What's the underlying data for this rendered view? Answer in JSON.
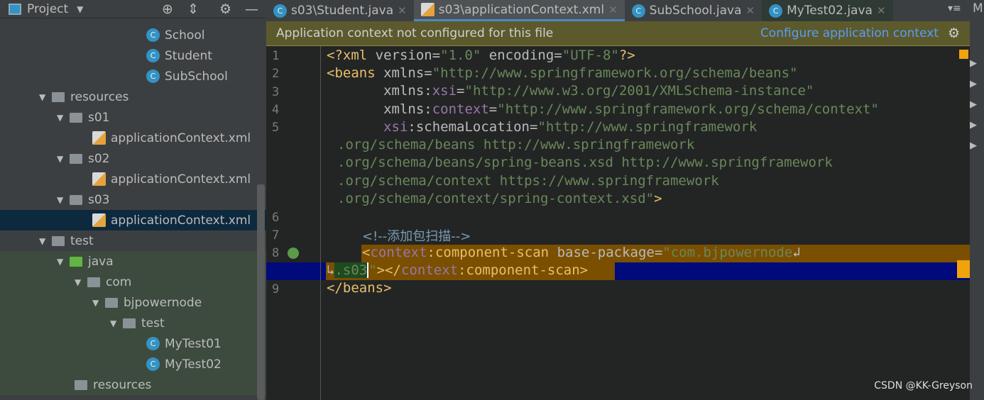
{
  "project_panel": {
    "title": "Project",
    "tree": [
      {
        "label": "School",
        "type": "class",
        "indent": 206
      },
      {
        "label": "Student",
        "type": "class",
        "indent": 206
      },
      {
        "label": "SubSchool",
        "type": "class",
        "indent": 206
      },
      {
        "label": "resources",
        "type": "resfolder",
        "indent": 55,
        "open": true
      },
      {
        "label": "s01",
        "type": "folder",
        "indent": 80,
        "open": true
      },
      {
        "label": "applicationContext.xml",
        "type": "xml",
        "indent": 130
      },
      {
        "label": "s02",
        "type": "folder",
        "indent": 80,
        "open": true
      },
      {
        "label": "applicationContext.xml",
        "type": "xml",
        "indent": 130
      },
      {
        "label": "s03",
        "type": "folder",
        "indent": 80,
        "open": true
      },
      {
        "label": "applicationContext.xml",
        "type": "xml",
        "indent": 130,
        "selected": true
      },
      {
        "label": "test",
        "type": "folder",
        "indent": 55,
        "open": true
      },
      {
        "label": "java",
        "type": "gfolder",
        "indent": 80,
        "open": true,
        "green": true
      },
      {
        "label": "com",
        "type": "folder",
        "indent": 105,
        "open": true,
        "green": true
      },
      {
        "label": "bjpowernode",
        "type": "folder",
        "indent": 130,
        "open": true,
        "green": true
      },
      {
        "label": "test",
        "type": "folder",
        "indent": 155,
        "open": true,
        "green": true
      },
      {
        "label": "MyTest01",
        "type": "class",
        "indent": 206,
        "green": true
      },
      {
        "label": "MyTest02",
        "type": "class",
        "indent": 206,
        "green": true
      },
      {
        "label": "resources",
        "type": "resfolder",
        "indent": 105,
        "green": true
      }
    ]
  },
  "tabs": [
    {
      "label": "s03\\Student.java",
      "icon": "class"
    },
    {
      "label": "s03\\applicationContext.xml",
      "icon": "xml",
      "active": true
    },
    {
      "label": "SubSchool.java",
      "icon": "class"
    },
    {
      "label": "MyTest02.java",
      "icon": "class",
      "alt": true
    }
  ],
  "banner": {
    "message": "Application context not configured for this file",
    "link": "Configure application context"
  },
  "editor": {
    "line_numbers": [
      "1",
      "2",
      "3",
      "4",
      "5",
      "",
      "",
      "",
      "",
      "6",
      "7",
      "8",
      "",
      "9"
    ],
    "comment": "<!--添加包扫描-->"
  },
  "watermark": "CSDN @KK-Greyson",
  "right_strip": "M"
}
